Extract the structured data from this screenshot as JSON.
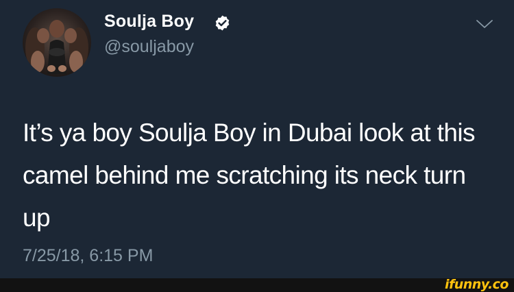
{
  "tweet": {
    "display_name": "Soulja Boy",
    "handle": "@souljaboy",
    "text": "It’s ya boy Soulja Boy in Dubai look at this camel behind me scratching its neck turn up",
    "timestamp": "7/25/18, 6:15 PM",
    "verified": true,
    "icons": {
      "verified": "verified-badge-icon",
      "menu": "chevron-down-icon",
      "avatar": "profile-photo"
    }
  },
  "footer": {
    "watermark": "ifunny.co"
  },
  "colors": {
    "background": "#1c2735",
    "primary_text": "#ffffff",
    "secondary_text": "#8899a6",
    "watermark": "#ffc20e",
    "footer_bar": "#121212"
  }
}
